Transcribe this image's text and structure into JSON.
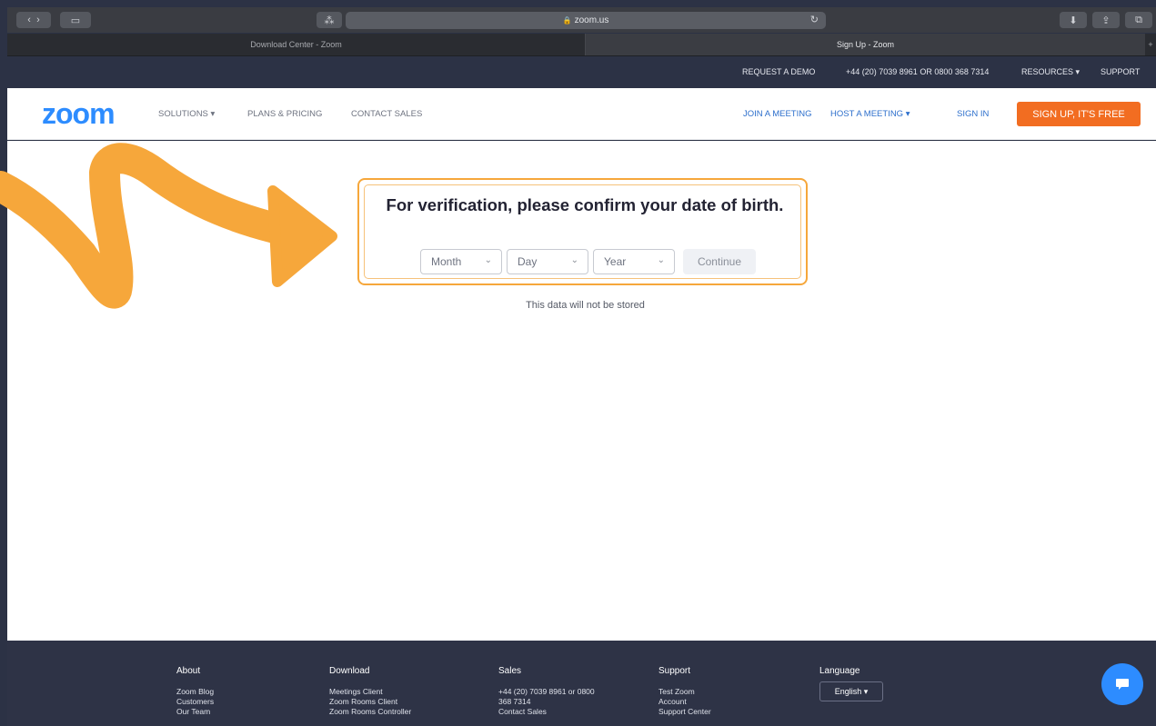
{
  "browser": {
    "address": "zoom.us",
    "tabs": [
      {
        "label": "Download Center - Zoom"
      },
      {
        "label": "Sign Up - Zoom"
      }
    ]
  },
  "utility": {
    "request_demo": "REQUEST A DEMO",
    "phone": "+44 (20) 7039 8961 OR 0800 368 7314",
    "resources": "RESOURCES",
    "support": "SUPPORT"
  },
  "nav": {
    "logo": "zoom",
    "solutions": "SOLUTIONS",
    "plans": "PLANS & PRICING",
    "contact": "CONTACT SALES",
    "join": "JOIN A MEETING",
    "host": "HOST A MEETING",
    "signin": "SIGN IN",
    "signup": "SIGN UP, IT'S FREE"
  },
  "verification": {
    "title": "For verification, please confirm your date of birth.",
    "month": "Month",
    "day": "Day",
    "year": "Year",
    "continue": "Continue",
    "note": "This data will not be stored"
  },
  "footer": {
    "about": {
      "title": "About",
      "items": [
        "Zoom Blog",
        "Customers",
        "Our Team"
      ]
    },
    "download": {
      "title": "Download",
      "items": [
        "Meetings Client",
        "Zoom Rooms Client",
        "Zoom Rooms Controller"
      ]
    },
    "sales": {
      "title": "Sales",
      "items": [
        "+44 (20) 7039 8961 or 0800",
        "368 7314",
        "Contact Sales"
      ]
    },
    "support": {
      "title": "Support",
      "items": [
        "Test Zoom",
        "Account",
        "Support Center"
      ]
    },
    "language": {
      "title": "Language",
      "value": "English"
    }
  },
  "colors": {
    "brand_blue": "#2d8cff",
    "signup_orange": "#f26d21",
    "highlight_orange": "#f6a73b",
    "dark_bg": "#2c3245"
  },
  "icons": [
    "back-icon",
    "forward-icon",
    "sidebar-icon",
    "reader-icon",
    "lock-icon",
    "reload-icon",
    "download-icon",
    "share-icon",
    "tabs-icon",
    "chevron-down-icon",
    "chat-icon",
    "arrow-annotation"
  ]
}
